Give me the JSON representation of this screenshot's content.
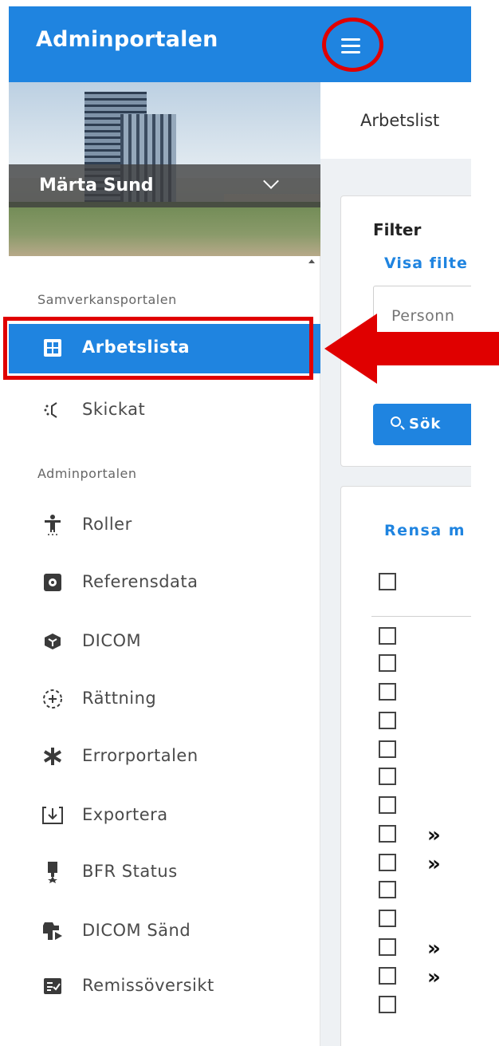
{
  "header": {
    "app_title": "Adminportalen",
    "menu_icon": "hamburger-icon"
  },
  "user": {
    "name": "Märta Sund"
  },
  "sidebar": {
    "sections": [
      {
        "title": "Samverkansportalen"
      },
      {
        "title": "Adminportalen"
      }
    ],
    "items": [
      {
        "label": "Arbetslista",
        "icon": "grid-icon",
        "active": true
      },
      {
        "label": "Skickat",
        "icon": "sent-icon"
      },
      {
        "label": "Roller",
        "icon": "person-icon"
      },
      {
        "label": "Referensdata",
        "icon": "settings-box-icon"
      },
      {
        "label": "DICOM",
        "icon": "cube-icon"
      },
      {
        "label": "Rättning",
        "icon": "correction-icon"
      },
      {
        "label": "Errorportalen",
        "icon": "asterisk-icon"
      },
      {
        "label": "Exportera",
        "icon": "export-icon"
      },
      {
        "label": "BFR Status",
        "icon": "badge-icon"
      },
      {
        "label": "DICOM Sänd",
        "icon": "send-icon"
      },
      {
        "label": "Remissöversikt",
        "icon": "checklist-icon"
      }
    ]
  },
  "main": {
    "breadcrumb": "Arbetslist",
    "filter": {
      "title": "Filter",
      "show_filter_link": "Visa filte",
      "input_placeholder": "Personn",
      "search_button": "Sök"
    },
    "list": {
      "clear_link": "Rensa m"
    }
  },
  "colors": {
    "primary": "#1f84e0",
    "annotation": "#e00000"
  }
}
